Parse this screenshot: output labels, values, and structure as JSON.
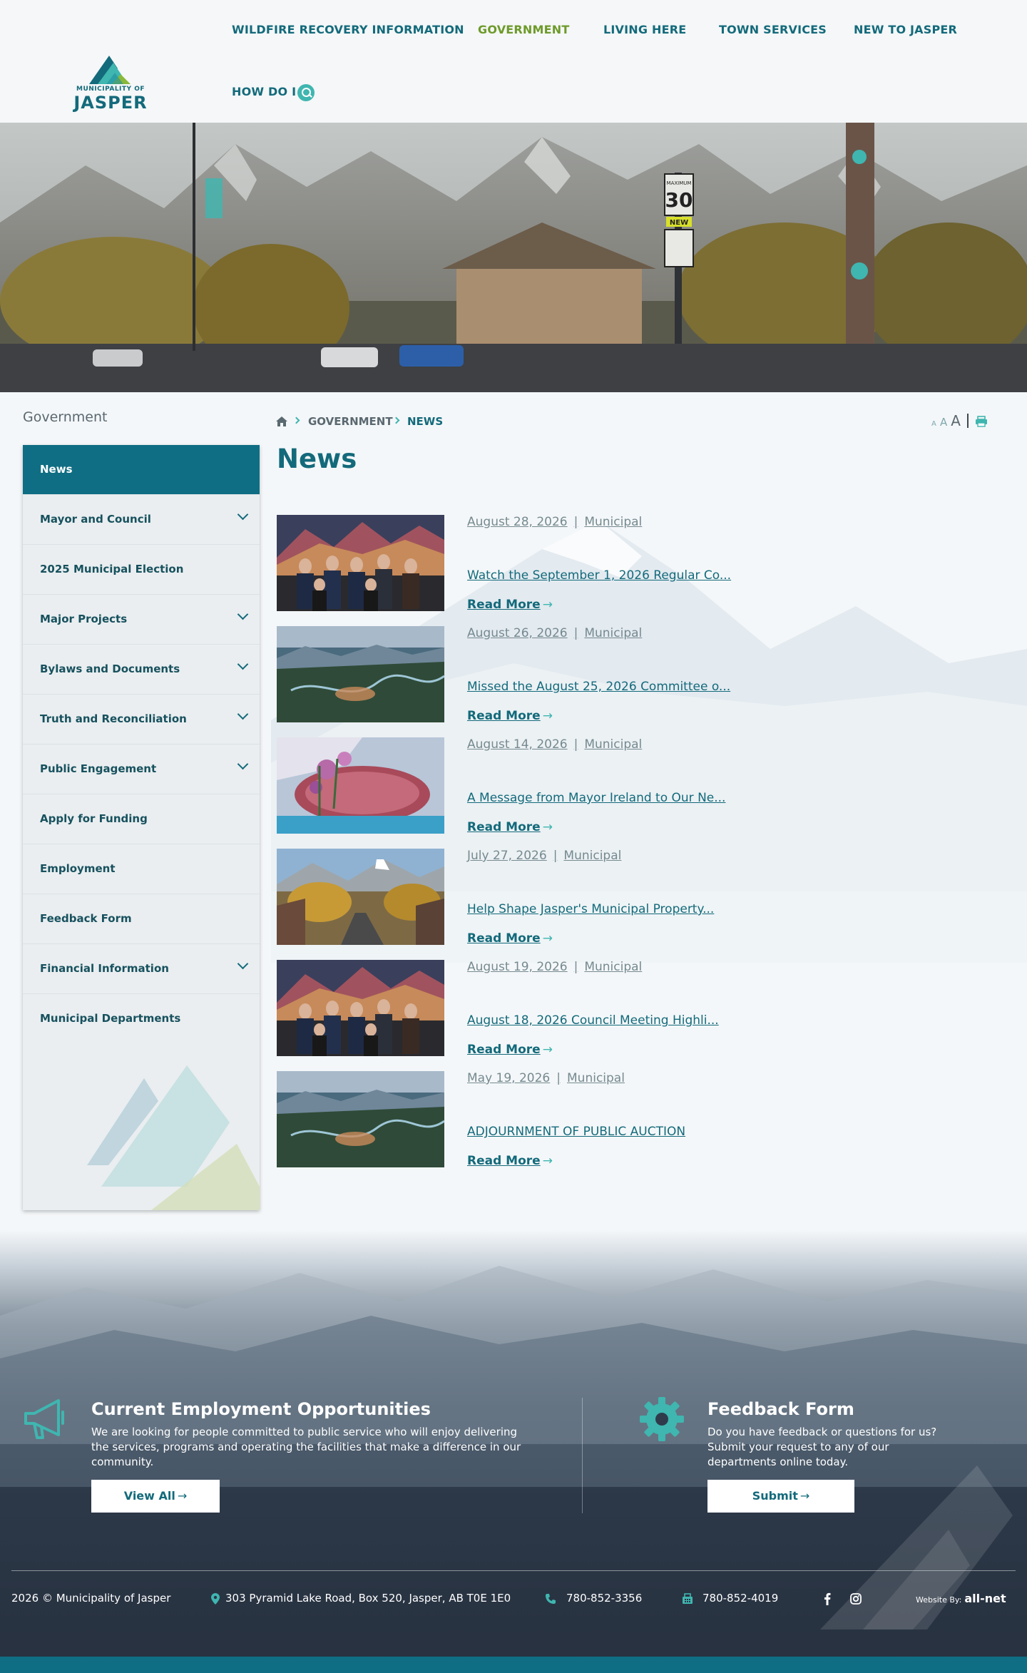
{
  "logo": {
    "small_text": "MUNICIPALITY OF",
    "big_text": "JASPER"
  },
  "nav": {
    "items": [
      {
        "label": "WILDFIRE RECOVERY INFORMATION"
      },
      {
        "label": "GOVERNMENT",
        "active": true
      },
      {
        "label": "LIVING HERE"
      },
      {
        "label": "TOWN SERVICES"
      },
      {
        "label": "NEW TO JASPER"
      },
      {
        "label": "HOW DO I"
      }
    ]
  },
  "hero": {
    "sign_speed": "30",
    "sign_new": "NEW",
    "sign_max": "MAXIMUM"
  },
  "sidebar": {
    "section_title": "Government",
    "items": [
      {
        "label": "News",
        "active": true,
        "expandable": false
      },
      {
        "label": "Mayor and Council",
        "expandable": true
      },
      {
        "label": "2025 Municipal Election",
        "expandable": false
      },
      {
        "label": "Major Projects",
        "expandable": true
      },
      {
        "label": "Bylaws and Documents",
        "expandable": true
      },
      {
        "label": "Truth and Reconciliation",
        "expandable": true
      },
      {
        "label": "Public Engagement",
        "expandable": true
      },
      {
        "label": "Apply for Funding",
        "expandable": false
      },
      {
        "label": "Employment",
        "expandable": false
      },
      {
        "label": "Feedback Form",
        "expandable": false
      },
      {
        "label": "Financial Information",
        "expandable": true
      },
      {
        "label": "Municipal Departments",
        "expandable": false
      }
    ]
  },
  "breadcrumb": {
    "level1": "GOVERNMENT",
    "level2": "NEWS"
  },
  "text_tools": {
    "small": "A",
    "medium": "A",
    "large": "A"
  },
  "page": {
    "title": "News"
  },
  "news": {
    "read_more": "Read More",
    "separator": "|",
    "items": [
      {
        "date": "August 28, 2026",
        "category": "Municipal",
        "title": "Watch the September 1, 2026 Regular Co...",
        "image": "council-photo"
      },
      {
        "date": "August 26, 2026",
        "category": "Municipal",
        "title": "Missed the August 25, 2026 Committee o...",
        "image": "valley-aerial"
      },
      {
        "date": "August 14, 2026",
        "category": "Municipal",
        "title": "A Message from Mayor Ireland to Our Ne...",
        "image": "mural-flowers"
      },
      {
        "date": "July 27, 2026",
        "category": "Municipal",
        "title": "Help Shape Jasper's Municipal Property...",
        "image": "town-street"
      },
      {
        "date": "August 19, 2026",
        "category": "Municipal",
        "title": "August 18, 2026 Council Meeting Highli...",
        "image": "council-photo"
      },
      {
        "date": "May 19, 2026",
        "category": "Municipal",
        "title": "ADJOURNMENT OF PUBLIC AUCTION",
        "image": "valley-aerial"
      }
    ]
  },
  "cta": {
    "employment": {
      "title": "Current Employment Opportunities",
      "text": "We are looking for people committed to public service who will enjoy delivering the services, programs and operating the facilities that make a difference in our community.",
      "button": "View All",
      "icon": "megaphone-icon"
    },
    "feedback": {
      "title": "Feedback Form",
      "text": "Do you have feedback or questions for us? Submit your request to any of our departments online today.",
      "button": "Submit",
      "icon": "gear-icon"
    }
  },
  "footer": {
    "copyright": "2026 © Municipality of Jasper",
    "address": "303 Pyramid Lake Road, Box 520, Jasper, AB T0E 1E0",
    "phone": "780-852-3356",
    "fax": "780-852-4019",
    "credit_label": "Website By:",
    "credit_brand": "all-net"
  },
  "colors": {
    "primary": "#0f6e83",
    "accent": "#3fb6b0",
    "nav_active": "#6e9a2a"
  }
}
